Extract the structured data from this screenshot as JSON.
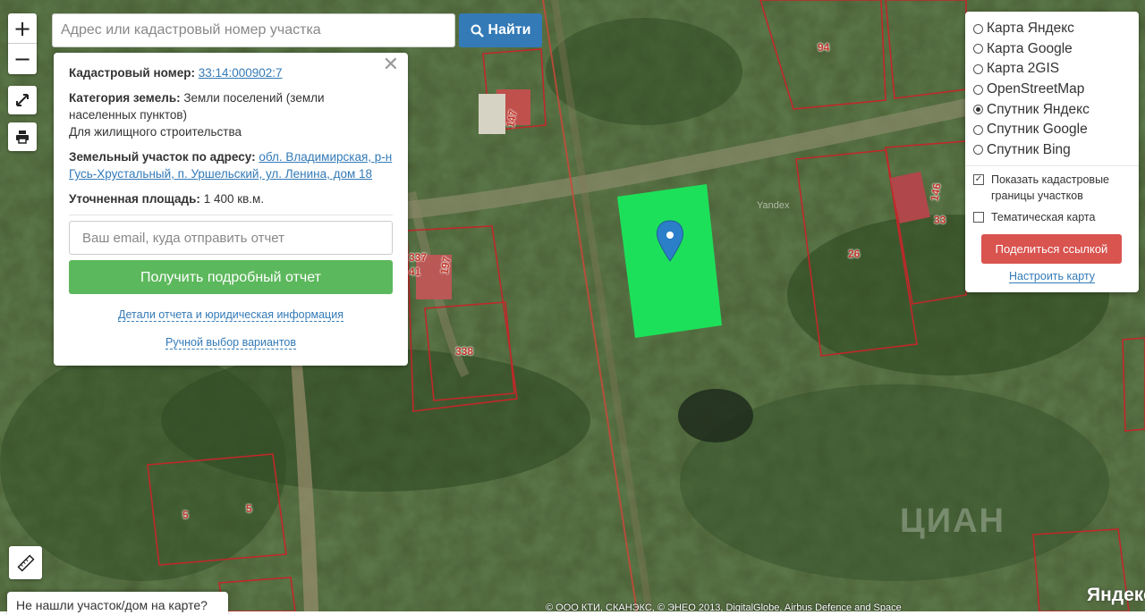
{
  "search": {
    "placeholder": "Адрес или кадастровый номер участка",
    "button_label": "Найти"
  },
  "zoom": {
    "in_label": "+",
    "out_label": "−"
  },
  "info": {
    "cadastral_label": "Кадастровый номер:",
    "cadastral_number": "33:14:000902:7",
    "category_label": "Категория земель:",
    "category_value": "Земли поселений (земли населенных пунктов)",
    "use_value": "Для жилищного строительства",
    "address_label": "Земельный участок по адресу:",
    "address_value": "обл. Владимирская, р-н Гусь-Хрустальный, п. Уршельский, ул. Ленина, дом 18",
    "area_label": "Уточненная площадь:",
    "area_value": "1 400 кв.м.",
    "email_placeholder": "Ваш email, куда отправить отчет",
    "report_button": "Получить подробный отчет",
    "details_link": "Детали отчета и юридическая информация",
    "manual_link": "Ручной выбор вариантов",
    "close_glyph": "✕"
  },
  "layers": {
    "options": [
      {
        "label": "Карта Яндекс",
        "selected": false
      },
      {
        "label": "Карта Google",
        "selected": false
      },
      {
        "label": "Карта 2GIS",
        "selected": false
      },
      {
        "label": "OpenStreetMap",
        "selected": false
      },
      {
        "label": "Спутник Яндекс",
        "selected": true
      },
      {
        "label": "Спутник Google",
        "selected": false
      },
      {
        "label": "Спутник Bing",
        "selected": false
      }
    ],
    "show_borders_label": "Показать кадастровые границы участков",
    "show_borders_checked": true,
    "thematic_label": "Тематическая карта",
    "thematic_checked": false,
    "share_button": "Поделиться ссылкой",
    "setup_link": "Настроить карту"
  },
  "plot_labels": [
    "94",
    "147",
    "146",
    "33",
    "26",
    "337",
    "41",
    "197",
    "338",
    "5",
    "5"
  ],
  "map_text": {
    "yandex_mark": "Yandex",
    "logo": "Яндекс",
    "watermark": "ЦИАН",
    "copyright": "© ООО КТИ, СКАНЭКС, © ЭНЕО 2013, DigitalGlobe, Airbus Defence and Space"
  },
  "not_found_label": "Не нашли участок/дом на карте?",
  "colors": {
    "highlight": "#1de05a",
    "marker": "#2b7fc9",
    "border": "#c0392b",
    "search_btn": "#337ab7",
    "report_btn": "#5cb85c",
    "share_btn": "#d9534f"
  }
}
